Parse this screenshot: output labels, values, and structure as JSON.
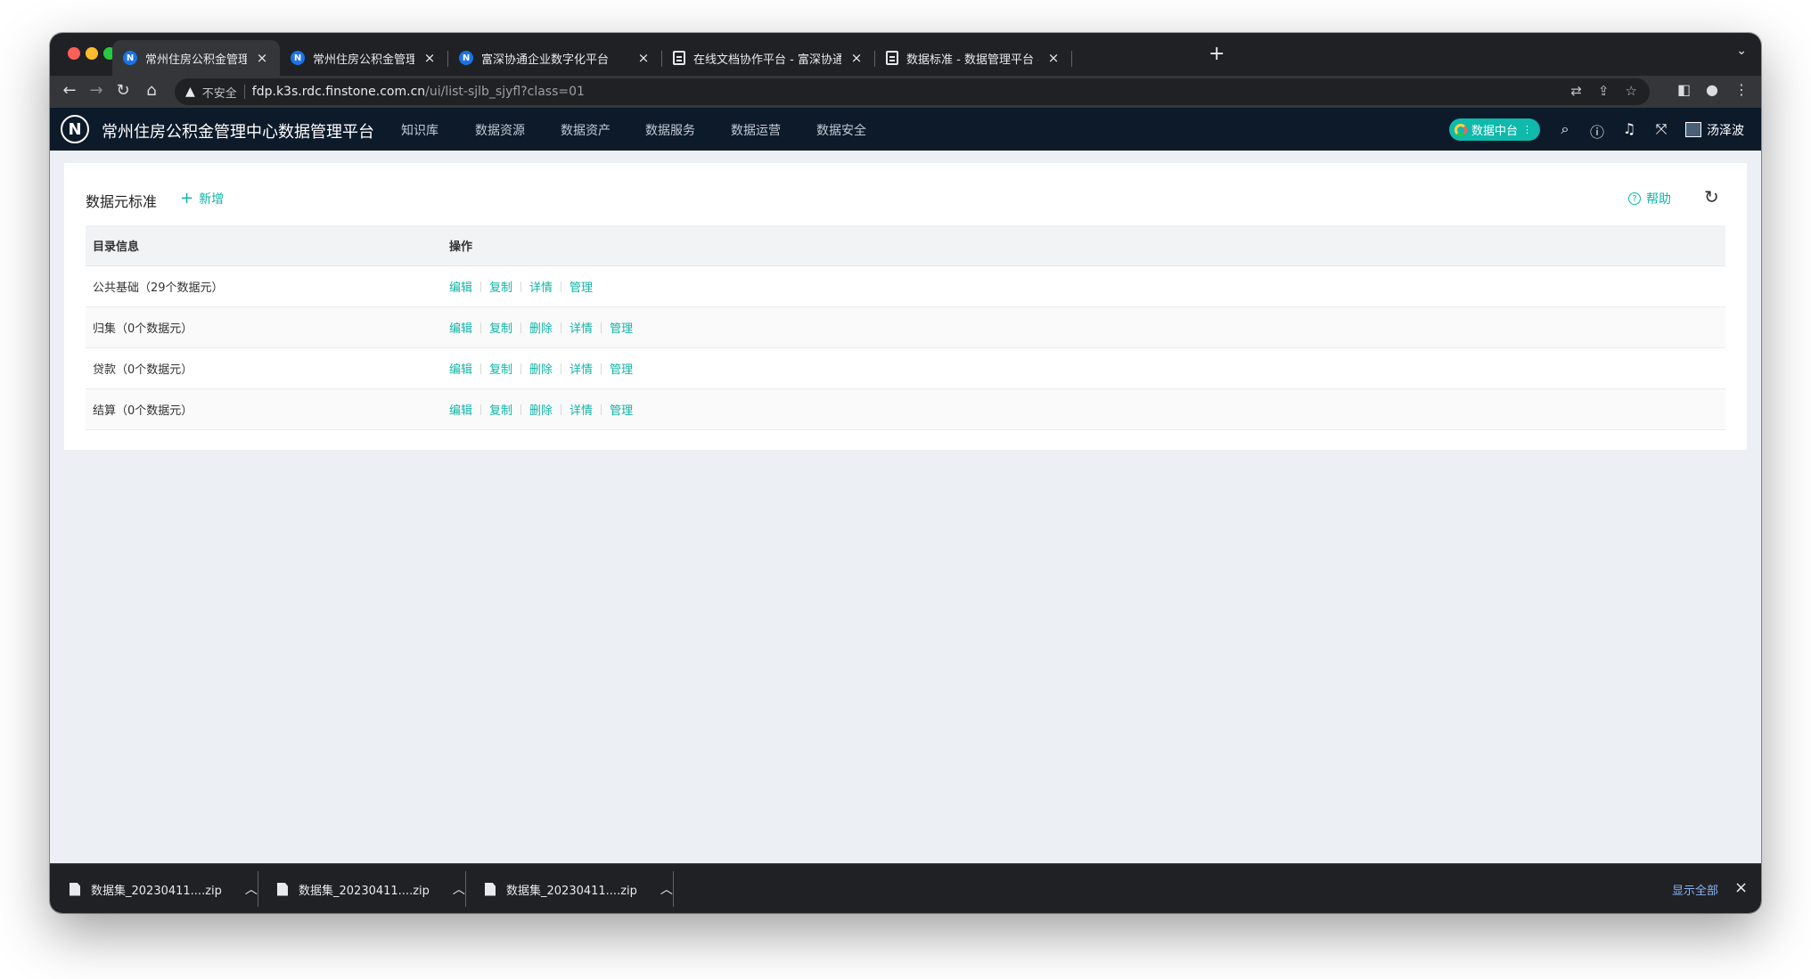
{
  "browser": {
    "tabs": [
      {
        "title": "常州住房公积金管理中心数据管理",
        "favicon": "n-logo-icon",
        "active": true
      },
      {
        "title": "常州住房公积金管理中心数据管",
        "favicon": "n-logo-icon",
        "active": false
      },
      {
        "title": "富深协通企业数字化平台",
        "favicon": "n-logo-icon",
        "active": false
      },
      {
        "title": "在线文档协作平台 - 富深协通",
        "favicon": "document-icon",
        "active": false
      },
      {
        "title": "数据标准 - 数据管理平台 - 在线",
        "favicon": "document-icon",
        "active": false
      }
    ],
    "close_glyph": "×",
    "new_tab_glyph": "+",
    "address": {
      "security_label": "不安全",
      "host": "fdp.k3s.rdc.finstone.com.cn",
      "path": "/ui/list-sjlb_sjyfl?class=01"
    }
  },
  "header": {
    "logo_letter": "N",
    "title": "常州住房公积金管理中心数据管理平台",
    "menu": [
      "知识库",
      "数据资源",
      "数据资产",
      "数据服务",
      "数据运营",
      "数据安全"
    ],
    "platform_pill": "数据中台",
    "username": "汤泽波"
  },
  "page": {
    "title": "数据元标准",
    "add_label": "新增",
    "help_label": "帮助"
  },
  "table": {
    "headers": [
      "目录信息",
      "操作"
    ],
    "rows": [
      {
        "name": "公共基础（29个数据元）",
        "actions": [
          "编辑",
          "复制",
          "详情",
          "管理"
        ]
      },
      {
        "name": "归集（0个数据元）",
        "actions": [
          "编辑",
          "复制",
          "删除",
          "详情",
          "管理"
        ]
      },
      {
        "name": "贷款（0个数据元）",
        "actions": [
          "编辑",
          "复制",
          "删除",
          "详情",
          "管理"
        ]
      },
      {
        "name": "结算（0个数据元）",
        "actions": [
          "编辑",
          "复制",
          "删除",
          "详情",
          "管理"
        ]
      }
    ]
  },
  "downloads": {
    "items": [
      "数据集_20230411....zip",
      "数据集_20230411....zip",
      "数据集_20230411....zip"
    ],
    "show_all": "显示全部"
  },
  "colors": {
    "accent": "#10b4a7",
    "header_bg": "#0c1a2a",
    "page_bg": "#eceff3"
  }
}
